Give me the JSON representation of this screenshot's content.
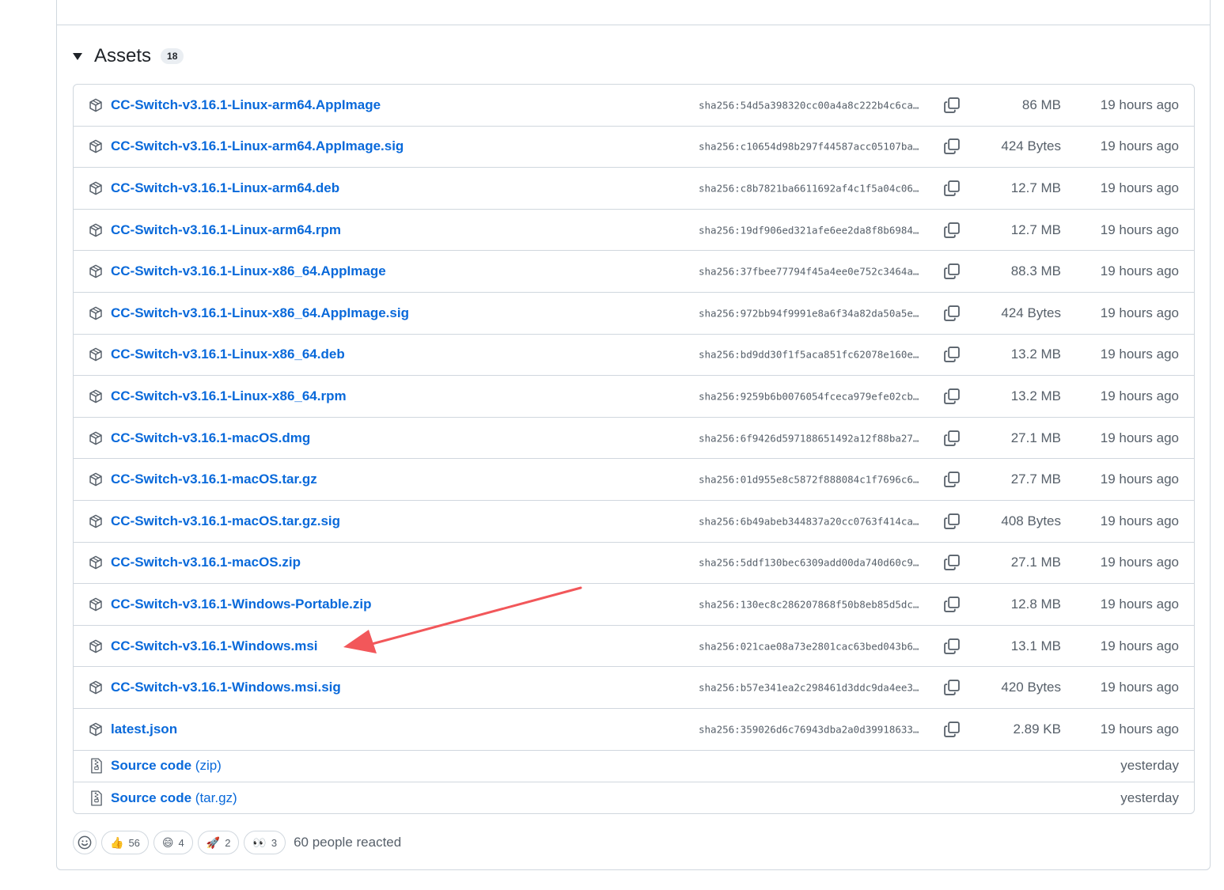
{
  "assets_header": {
    "title": "Assets",
    "count": "18"
  },
  "assets": [
    {
      "name": "CC-Switch-v3.16.1-Linux-arm64.AppImage",
      "sha": "sha256:54d5a398320cc00a4a8c222b4c6ca…",
      "size": "86 MB",
      "age": "19 hours ago"
    },
    {
      "name": "CC-Switch-v3.16.1-Linux-arm64.AppImage.sig",
      "sha": "sha256:c10654d98b297f44587acc05107ba…",
      "size": "424 Bytes",
      "age": "19 hours ago"
    },
    {
      "name": "CC-Switch-v3.16.1-Linux-arm64.deb",
      "sha": "sha256:c8b7821ba6611692af4c1f5a04c06…",
      "size": "12.7 MB",
      "age": "19 hours ago"
    },
    {
      "name": "CC-Switch-v3.16.1-Linux-arm64.rpm",
      "sha": "sha256:19df906ed321afe6ee2da8f8b6984…",
      "size": "12.7 MB",
      "age": "19 hours ago"
    },
    {
      "name": "CC-Switch-v3.16.1-Linux-x86_64.AppImage",
      "sha": "sha256:37fbee77794f45a4ee0e752c3464a…",
      "size": "88.3 MB",
      "age": "19 hours ago"
    },
    {
      "name": "CC-Switch-v3.16.1-Linux-x86_64.AppImage.sig",
      "sha": "sha256:972bb94f9991e8a6f34a82da50a5e…",
      "size": "424 Bytes",
      "age": "19 hours ago"
    },
    {
      "name": "CC-Switch-v3.16.1-Linux-x86_64.deb",
      "sha": "sha256:bd9dd30f1f5aca851fc62078e160e…",
      "size": "13.2 MB",
      "age": "19 hours ago"
    },
    {
      "name": "CC-Switch-v3.16.1-Linux-x86_64.rpm",
      "sha": "sha256:9259b6b0076054fceca979efe02cb…",
      "size": "13.2 MB",
      "age": "19 hours ago"
    },
    {
      "name": "CC-Switch-v3.16.1-macOS.dmg",
      "sha": "sha256:6f9426d597188651492a12f88ba27…",
      "size": "27.1 MB",
      "age": "19 hours ago"
    },
    {
      "name": "CC-Switch-v3.16.1-macOS.tar.gz",
      "sha": "sha256:01d955e8c5872f888084c1f7696c6…",
      "size": "27.7 MB",
      "age": "19 hours ago"
    },
    {
      "name": "CC-Switch-v3.16.1-macOS.tar.gz.sig",
      "sha": "sha256:6b49abeb344837a20cc0763f414ca…",
      "size": "408 Bytes",
      "age": "19 hours ago"
    },
    {
      "name": "CC-Switch-v3.16.1-macOS.zip",
      "sha": "sha256:5ddf130bec6309add00da740d60c9…",
      "size": "27.1 MB",
      "age": "19 hours ago"
    },
    {
      "name": "CC-Switch-v3.16.1-Windows-Portable.zip",
      "sha": "sha256:130ec8c286207868f50b8eb85d5dc…",
      "size": "12.8 MB",
      "age": "19 hours ago"
    },
    {
      "name": "CC-Switch-v3.16.1-Windows.msi",
      "sha": "sha256:021cae08a73e2801cac63bed043b6…",
      "size": "13.1 MB",
      "age": "19 hours ago"
    },
    {
      "name": "CC-Switch-v3.16.1-Windows.msi.sig",
      "sha": "sha256:b57e341ea2c298461d3ddc9da4ee3…",
      "size": "420 Bytes",
      "age": "19 hours ago"
    },
    {
      "name": "latest.json",
      "sha": "sha256:359026d6c76943dba2a0d39918633…",
      "size": "2.89 KB",
      "age": "19 hours ago"
    }
  ],
  "source_code": [
    {
      "label": "Source code",
      "suffix": "(zip)",
      "age": "yesterday"
    },
    {
      "label": "Source code",
      "suffix": "(tar.gz)",
      "age": "yesterday"
    }
  ],
  "reactions": {
    "items": [
      {
        "emoji": "👍",
        "count": "56"
      },
      {
        "emoji": "😄",
        "count": "4"
      },
      {
        "emoji": "🚀",
        "count": "2"
      },
      {
        "emoji": "👀",
        "count": "3"
      }
    ],
    "summary": "60 people reacted"
  },
  "icons": {
    "asset": "package-icon",
    "source": "file-zip-icon",
    "copy": "copy-icon",
    "add_reaction": "smiley-icon"
  },
  "colors": {
    "link": "#0969da",
    "muted": "#57606a",
    "border": "#d0d7de",
    "annotation_arrow": "#f2575a"
  }
}
